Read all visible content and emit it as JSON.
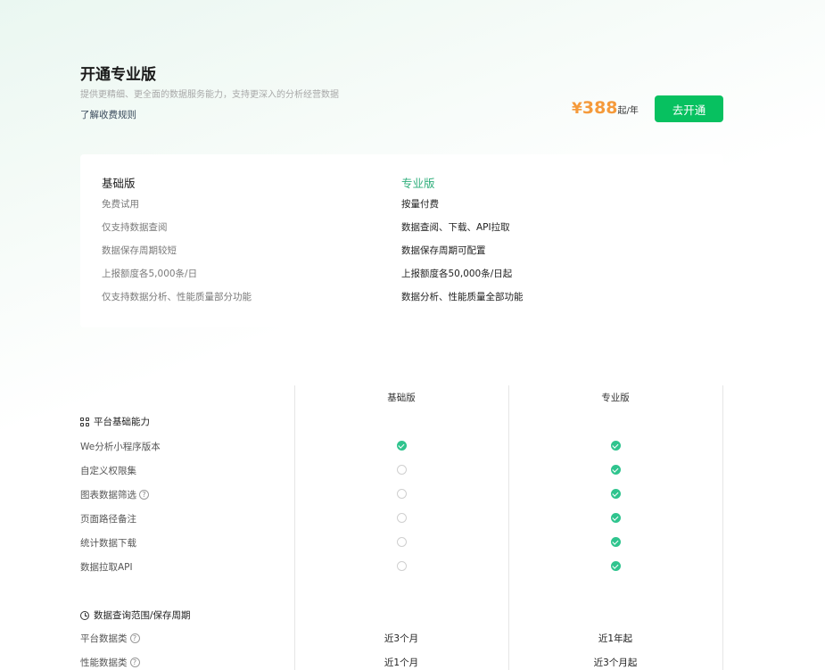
{
  "hero": {
    "title": "开通专业版",
    "description": "提供更精细、更全面的数据服务能力，支持更深入的分析经营数据",
    "link": "了解收费规则",
    "price_symbol": "¥",
    "price_value": "388",
    "price_unit": "起/年",
    "cta": "去开通"
  },
  "summary": {
    "basic": {
      "title": "基础版",
      "items": [
        "免费试用",
        "仅支持数据查阅",
        "数据保存周期较短",
        "上报额度各5,000条/日",
        "仅支持数据分析、性能质量部分功能"
      ]
    },
    "pro": {
      "title": "专业版",
      "items": [
        "按量付费",
        "数据查阅、下载、API拉取",
        "数据保存周期可配置",
        "上报额度各50,000条/日起",
        "数据分析、性能质量全部功能"
      ]
    }
  },
  "table": {
    "columns": [
      "基础版",
      "专业版"
    ],
    "section1": {
      "title": "平台基础能力",
      "icon": "grid-icon",
      "rows": [
        {
          "name": "We分析小程序版本",
          "help": false,
          "basic": true,
          "pro": true
        },
        {
          "name": "自定义权限集",
          "help": false,
          "basic": false,
          "pro": true
        },
        {
          "name": "图表数据筛选",
          "help": true,
          "basic": false,
          "pro": true
        },
        {
          "name": "页面路径备注",
          "help": false,
          "basic": false,
          "pro": true
        },
        {
          "name": "统计数据下载",
          "help": false,
          "basic": false,
          "pro": true
        },
        {
          "name": "数据拉取API",
          "help": false,
          "basic": false,
          "pro": true
        }
      ]
    },
    "section2": {
      "title": "数据查询范围/保存周期",
      "icon": "clock-icon",
      "rows": [
        {
          "name": "平台数据类",
          "help": true,
          "basic": "近3个月",
          "pro": "近1年起"
        },
        {
          "name": "性能数据类",
          "help": true,
          "basic": "近1个月",
          "pro": "近3个月起"
        }
      ]
    },
    "help_glyph": "?",
    "colors": {
      "accent": "#07c160",
      "check": "#2fc48e",
      "price": "#f59a3b",
      "pro_title": "#2fae7b"
    }
  }
}
